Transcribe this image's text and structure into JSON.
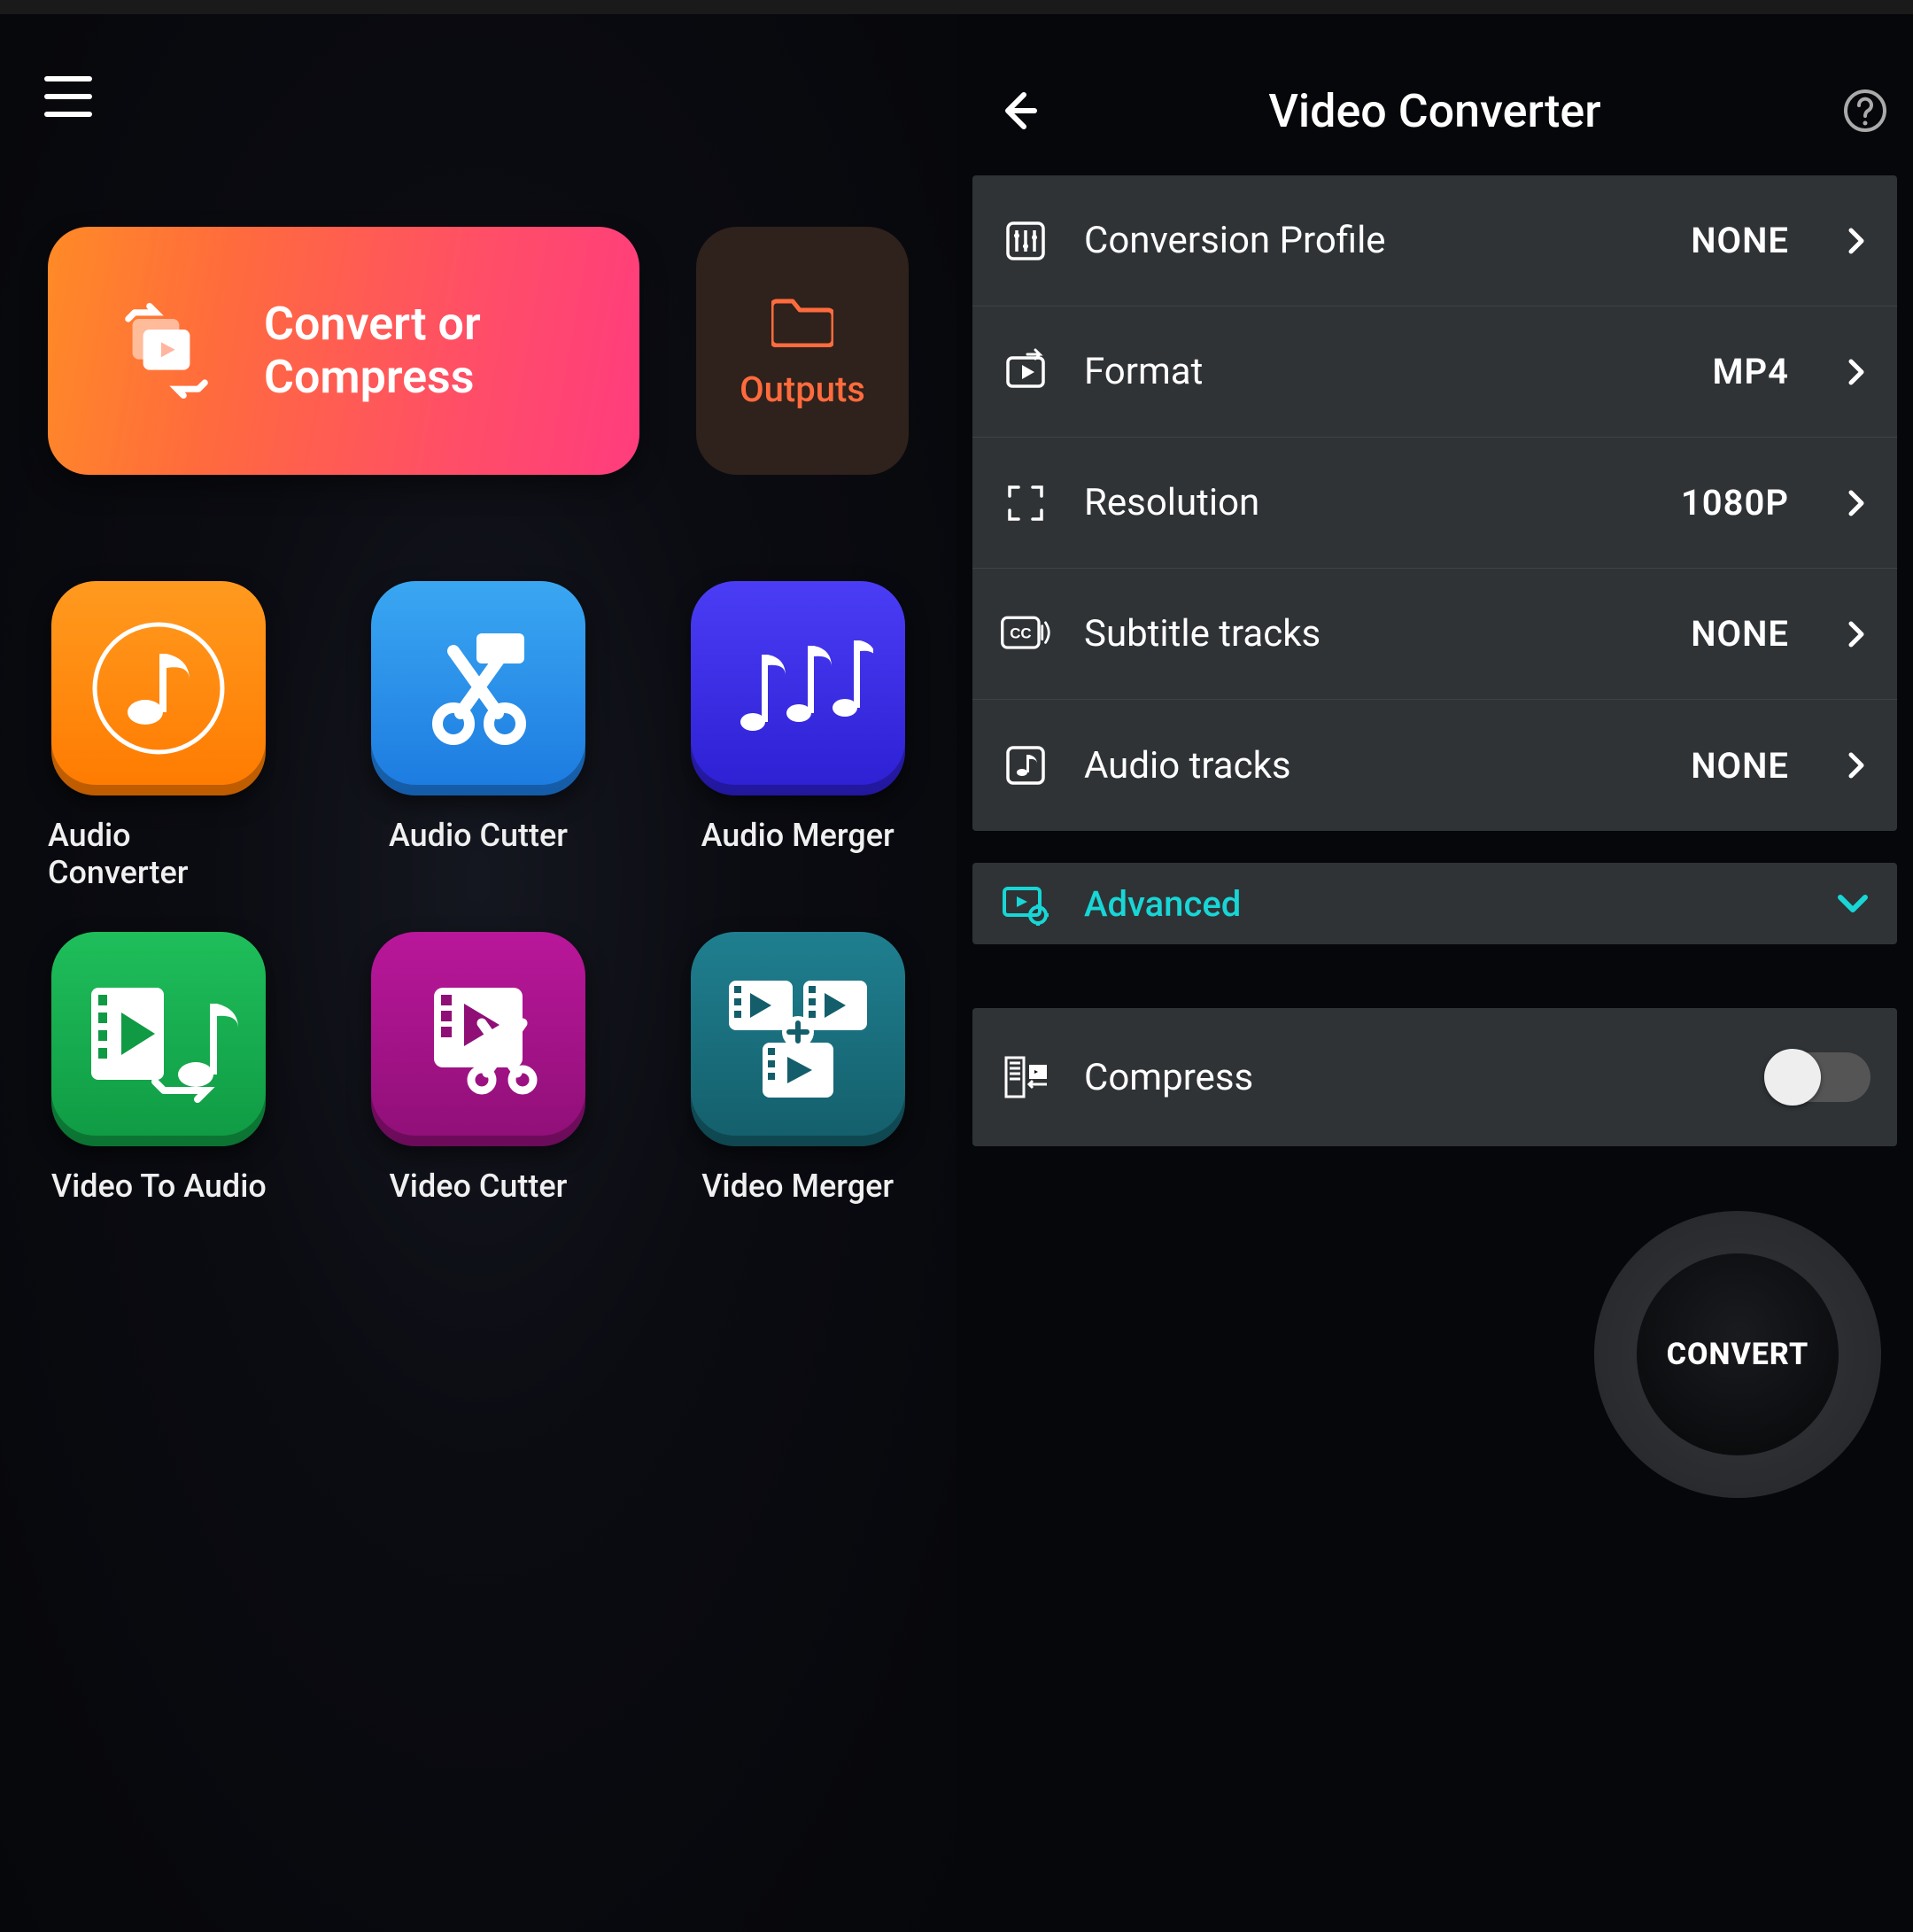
{
  "home": {
    "convert_label": "Convert or\nCompress",
    "outputs_label": "Outputs",
    "tools": [
      {
        "label": "Audio Converter",
        "color": "orange",
        "icon": "music-note"
      },
      {
        "label": "Audio Cutter",
        "color": "blue",
        "icon": "scissors"
      },
      {
        "label": "Audio Merger",
        "color": "indigo",
        "icon": "multi-music"
      },
      {
        "label": "Video To Audio",
        "color": "green",
        "icon": "video-to-audio"
      },
      {
        "label": "Video Cutter",
        "color": "magenta",
        "icon": "video-scissors"
      },
      {
        "label": "Video Merger",
        "color": "teal",
        "icon": "video-merge"
      }
    ]
  },
  "detail": {
    "title": "Video Converter",
    "settings": [
      {
        "key": "profile",
        "label": "Conversion Profile",
        "value": "NONE",
        "icon": "sliders"
      },
      {
        "key": "format",
        "label": "Format",
        "value": "MP4",
        "icon": "play-arrow"
      },
      {
        "key": "resolution",
        "label": "Resolution",
        "value": "1080P",
        "icon": "expand"
      },
      {
        "key": "subtitles",
        "label": "Subtitle tracks",
        "value": "NONE",
        "icon": "cc"
      },
      {
        "key": "audio",
        "label": "Audio tracks",
        "value": "NONE",
        "icon": "music-mini"
      }
    ],
    "advanced_label": "Advanced",
    "compress_label": "Compress",
    "compress_on": false,
    "convert_button": "CONVERT"
  },
  "colors": {
    "accent_teal": "#18d6d6",
    "accent_orange": "#FF6B3D"
  }
}
